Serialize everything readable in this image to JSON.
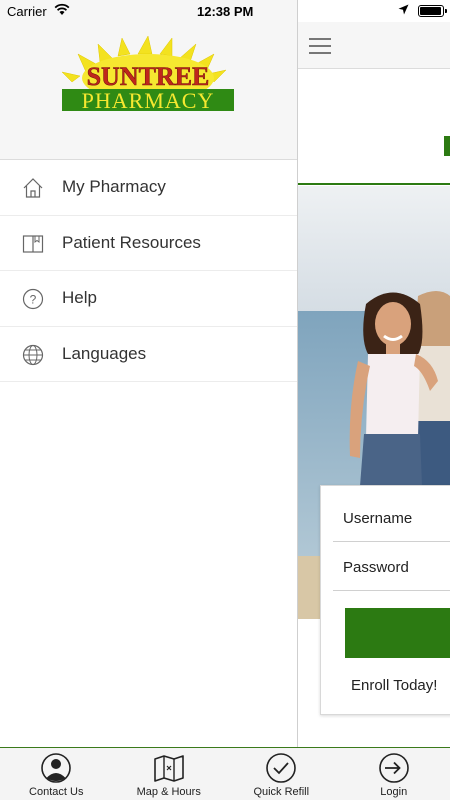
{
  "status": {
    "carrier": "Carrier",
    "time": "12:38 PM"
  },
  "logo": {
    "line1": "SUNTREE",
    "line2": "PHARMACY"
  },
  "drawer": {
    "items": [
      {
        "label": "My Pharmacy",
        "icon": "home-icon"
      },
      {
        "label": "Patient Resources",
        "icon": "book-icon"
      },
      {
        "label": "Help",
        "icon": "question-icon"
      },
      {
        "label": "Languages",
        "icon": "globe-icon"
      }
    ]
  },
  "login": {
    "username_label": "Username",
    "password_label": "Password",
    "enroll": "Enroll Today!"
  },
  "tabs": [
    {
      "label": "Contact Us",
      "icon": "contact-icon"
    },
    {
      "label": "Map & Hours",
      "icon": "map-icon"
    },
    {
      "label": "Quick Refill",
      "icon": "check-icon"
    },
    {
      "label": "Login",
      "icon": "login-icon"
    }
  ],
  "colors": {
    "brand_green": "#2c7a12",
    "logo_yellow": "#f3e21f",
    "logo_red": "#c0271b"
  }
}
